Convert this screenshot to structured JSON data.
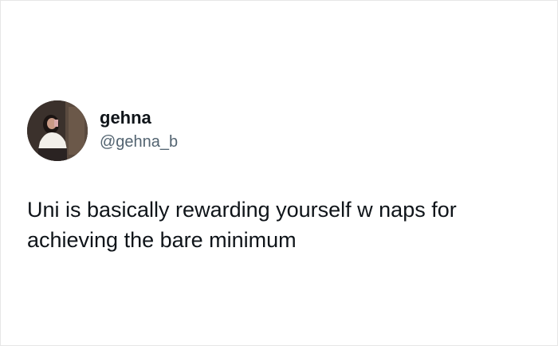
{
  "user": {
    "display_name": "gehna",
    "handle": "@gehna_b",
    "avatar_icon": "profile-photo"
  },
  "tweet": {
    "text": "Uni is basically rewarding yourself w naps for\nachieving the bare minimum"
  },
  "colors": {
    "text_primary": "#0f1419",
    "text_secondary": "#536471",
    "background": "#ffffff"
  }
}
